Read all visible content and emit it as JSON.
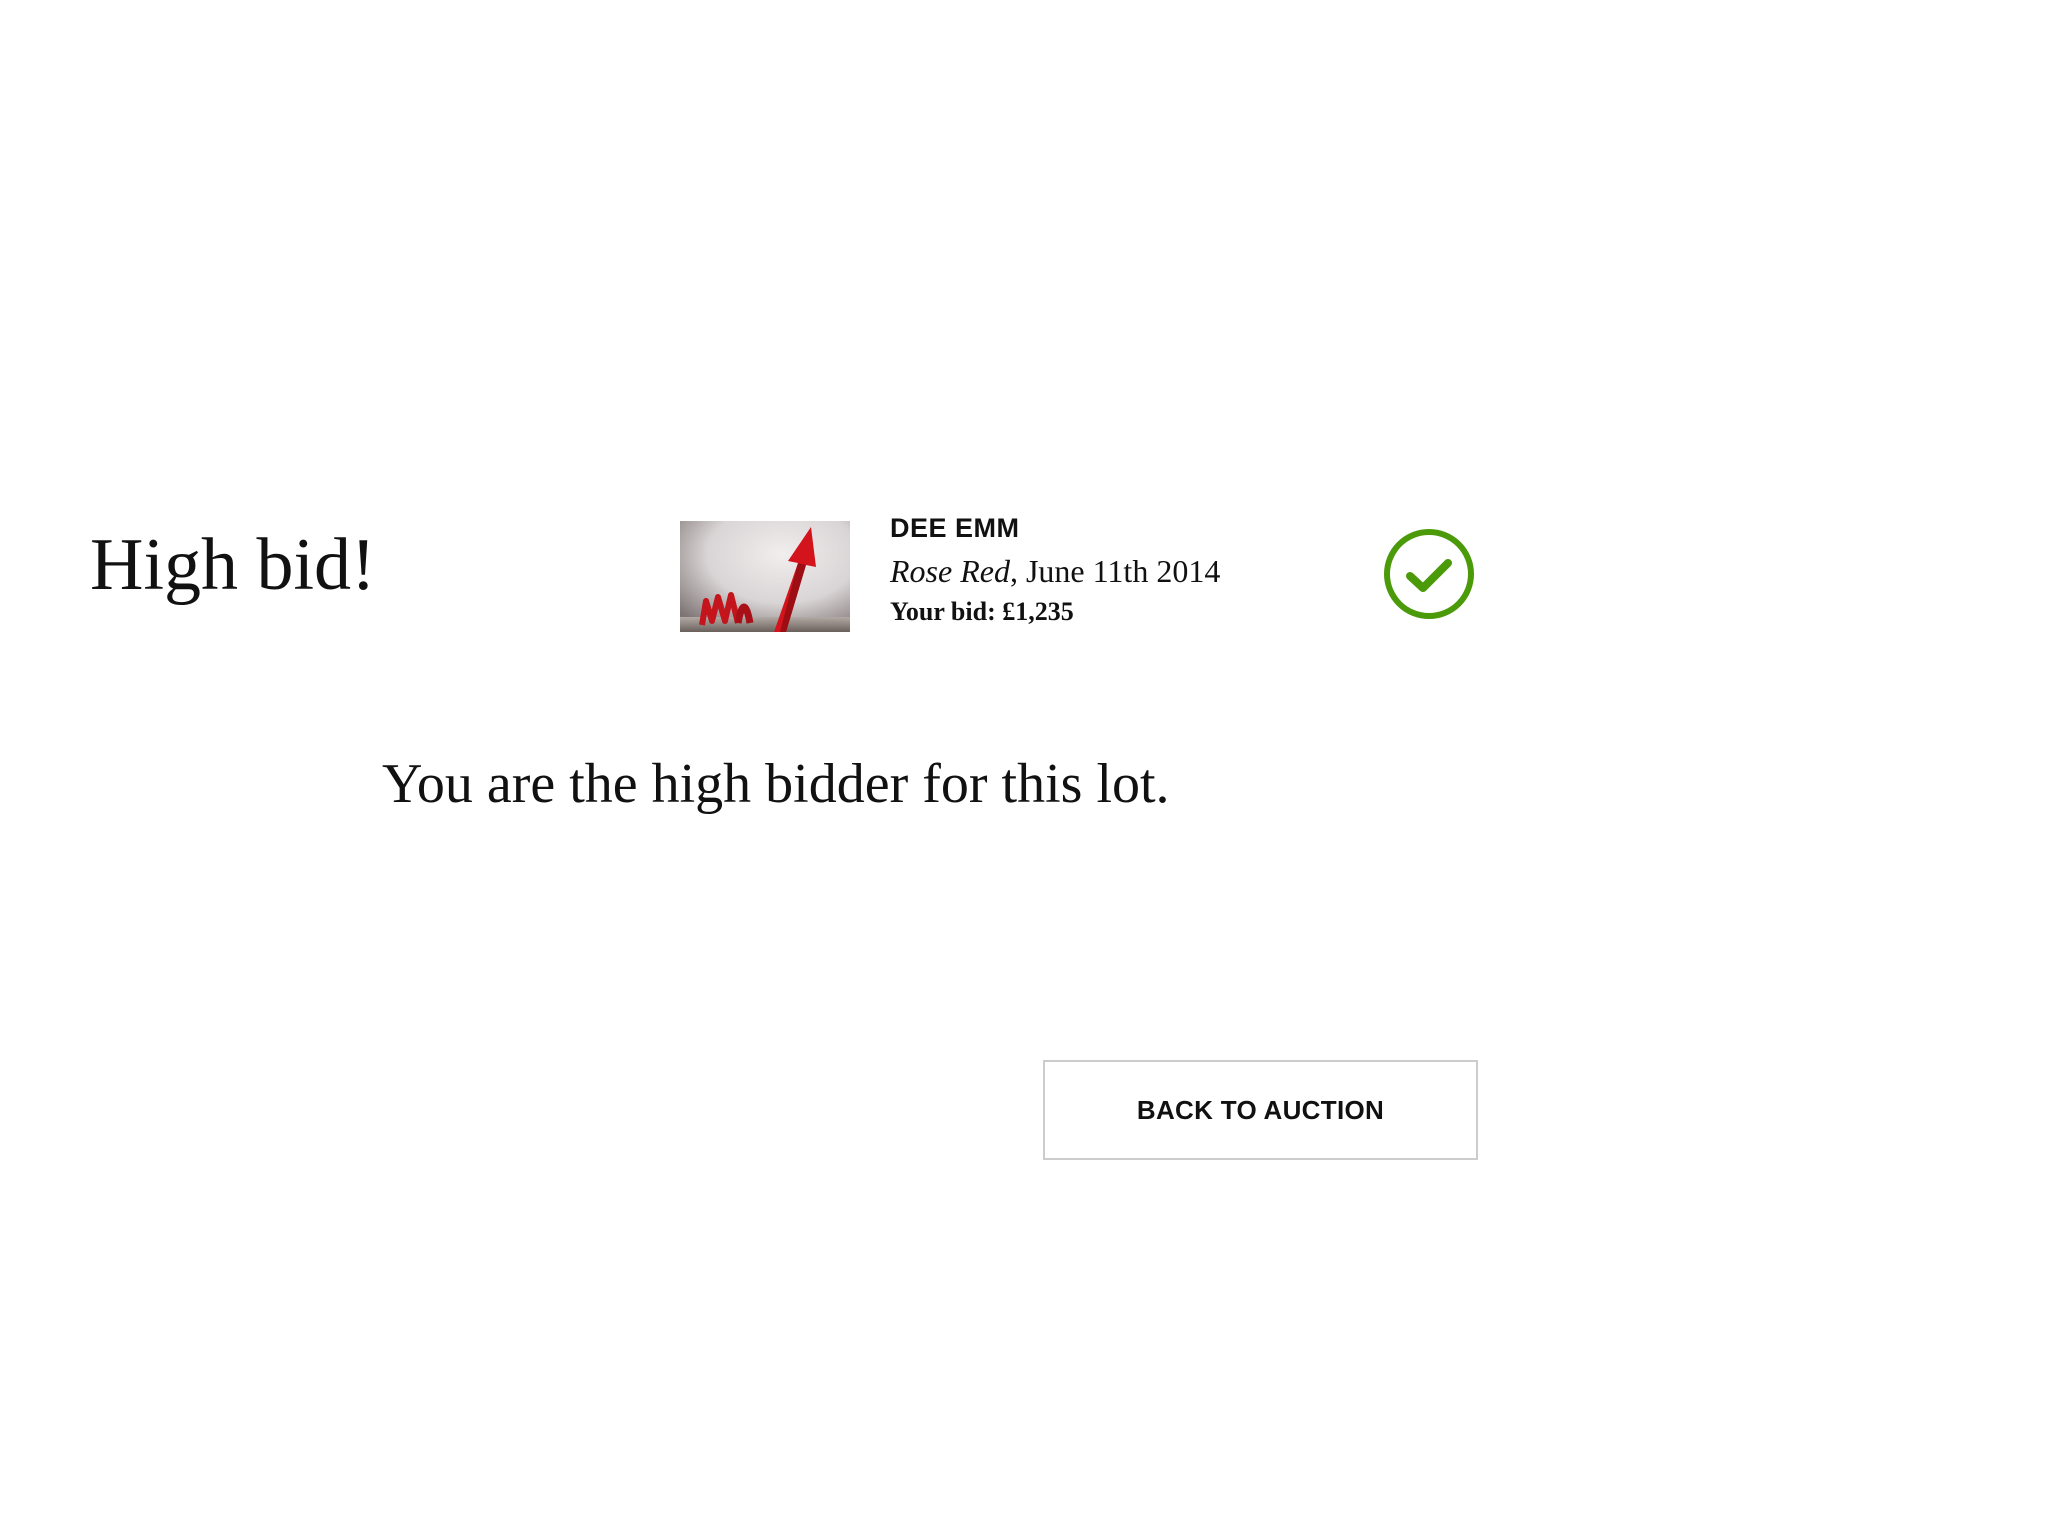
{
  "heading": "High bid!",
  "lot": {
    "artist": "DEE EMM",
    "title": "Rose Red",
    "date_suffix": ", June 11th 2014",
    "your_bid": "Your bid: £1,235",
    "thumbnail_icon": "rising-red-arrow-image"
  },
  "status": {
    "icon": "check-circle-icon",
    "color": "#4a9a0a"
  },
  "message": "You are the high bidder for this lot.",
  "actions": {
    "back_label": "BACK TO AUCTION"
  }
}
